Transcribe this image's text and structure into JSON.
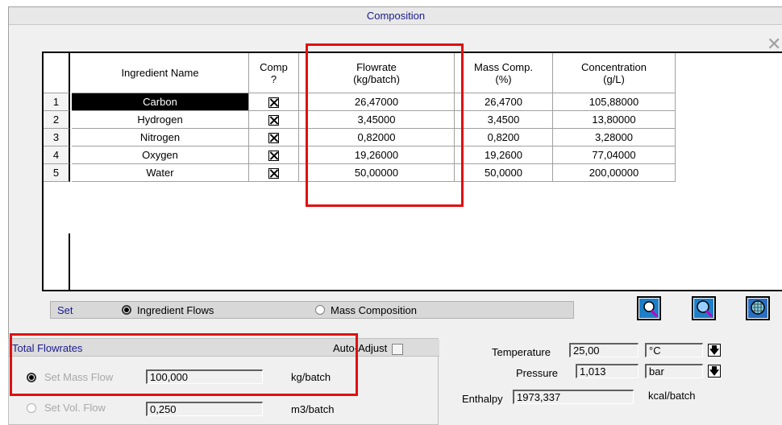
{
  "window": {
    "title": "Composition",
    "close_icon": "close-icon"
  },
  "table": {
    "columns": [
      "Ingredient Name",
      "Comp ?",
      "Flowrate (kg/batch)",
      "Mass Comp. (%)",
      "Concentration (g/L)"
    ],
    "col_lines": [
      [
        "Ingredient Name"
      ],
      [
        "Comp",
        "?"
      ],
      [
        "Flowrate",
        "(kg/batch)"
      ],
      [
        "Mass Comp.",
        "(%)"
      ],
      [
        "Concentration",
        "(g/L)"
      ]
    ],
    "rows": [
      {
        "num": "1",
        "name": "Carbon",
        "comp": true,
        "flowrate": "26,47000",
        "mass_comp": "26,4700",
        "concentration": "105,88000"
      },
      {
        "num": "2",
        "name": "Hydrogen",
        "comp": true,
        "flowrate": "3,45000",
        "mass_comp": "3,4500",
        "concentration": "13,80000"
      },
      {
        "num": "3",
        "name": "Nitrogen",
        "comp": true,
        "flowrate": "0,82000",
        "mass_comp": "0,8200",
        "concentration": "3,28000"
      },
      {
        "num": "4",
        "name": "Oxygen",
        "comp": true,
        "flowrate": "19,26000",
        "mass_comp": "19,2600",
        "concentration": "77,04000"
      },
      {
        "num": "5",
        "name": "Water",
        "comp": true,
        "flowrate": "50,00000",
        "mass_comp": "50,0000",
        "concentration": "200,00000"
      }
    ]
  },
  "set_bar": {
    "label": "Set",
    "option_flows": "Ingredient Flows",
    "option_mass": "Mass Composition",
    "selected": "Ingredient Flows"
  },
  "tool_icons": [
    "magnifier-icon",
    "magnifier-icon",
    "magnifier-grid-icon"
  ],
  "total_flowrates": {
    "header": "Total Flowrates",
    "auto_adjust_label": "Auto-Adjust",
    "auto_adjust_checked": false,
    "mass_flow_label": "Set Mass Flow",
    "mass_flow_value": "100,000",
    "mass_flow_unit": "kg/batch",
    "vol_flow_label": "Set Vol. Flow",
    "vol_flow_value": "0,250",
    "vol_flow_unit": "m3/batch",
    "selected": "mass"
  },
  "conditions": {
    "temperature_label": "Temperature",
    "temperature_value": "25,00",
    "temperature_unit": "°C",
    "pressure_label": "Pressure",
    "pressure_value": "1,013",
    "pressure_unit": "bar",
    "enthalpy_label": "Enthalpy",
    "enthalpy_value": "1973,337",
    "enthalpy_unit": "kcal/batch"
  },
  "colors": {
    "highlight": "#e01010",
    "header_text": "#1a1a8a"
  }
}
